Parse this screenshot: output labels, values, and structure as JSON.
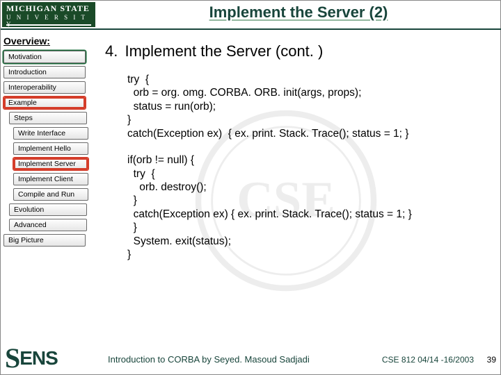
{
  "logo": {
    "line1": "MICHIGAN STATE",
    "line2": "U N I V E R S I T Y"
  },
  "title": "Implement the Server (2)",
  "sidebar": {
    "heading": "Overview:",
    "items": [
      {
        "label": "Motivation"
      },
      {
        "label": "Introduction"
      },
      {
        "label": "Interoperability"
      },
      {
        "label": "Example"
      },
      {
        "label": "Steps"
      },
      {
        "label": "Write Interface"
      },
      {
        "label": "Implement Hello"
      },
      {
        "label": "Implement Server"
      },
      {
        "label": "Implement Client"
      },
      {
        "label": "Compile and Run"
      },
      {
        "label": "Evolution"
      },
      {
        "label": "Advanced"
      },
      {
        "label": "Big Picture"
      }
    ]
  },
  "main": {
    "number": "4.",
    "heading": "Implement the Server (cont. )",
    "code": "try  {\n  orb = org. omg. CORBA. ORB. init(args, props);\n  status = run(orb);\n}\ncatch(Exception ex)  { ex. print. Stack. Trace(); status = 1; }\n\nif(orb != null) {\n  try  {\n    orb. destroy();\n  }\n  catch(Exception ex) { ex. print. Stack. Trace(); status = 1; }\n  }\n  System. exit(status);\n}"
  },
  "footer": {
    "sens_first": "S",
    "sens_rest": "ENS",
    "lecture": "Introduction to CORBA by Seyed. Masoud Sadjadi",
    "course": "CSE 812   04/14 -16/2003",
    "slide_no": "39"
  }
}
